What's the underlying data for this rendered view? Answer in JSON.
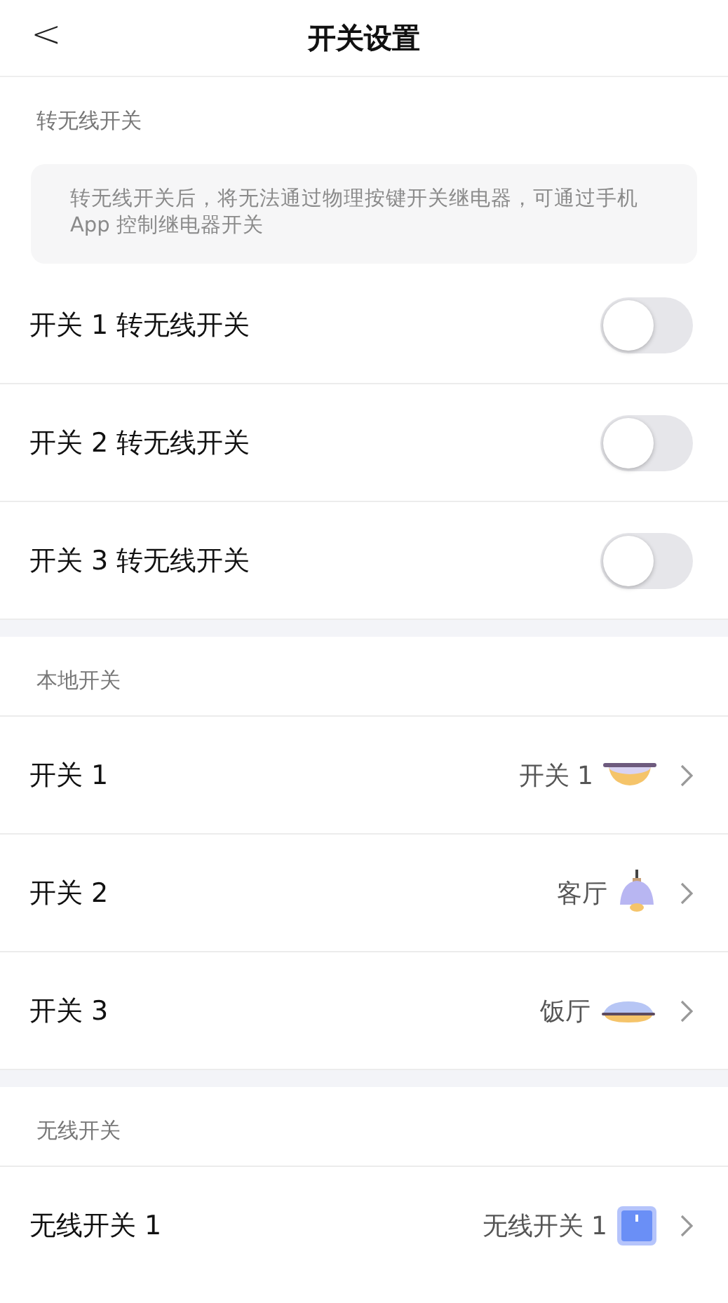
{
  "header": {
    "back": "<",
    "title": "开关设置"
  },
  "sections": [
    {
      "kind": "toggles",
      "title": "转无线开关",
      "note": "转无线开关后，将无法通过物理按键开关继电器，可通过手机 App 控制继电器开关",
      "items": [
        {
          "label": "开关 1 转无线开关",
          "on": false
        },
        {
          "label": "开关 2 转无线开关",
          "on": false
        },
        {
          "label": "开关 3 转无线开关",
          "on": false
        }
      ]
    },
    {
      "kind": "links",
      "title": "本地开关",
      "items": [
        {
          "label": "开关 1",
          "value": "开关 1",
          "kind": "ceiling"
        },
        {
          "label": "开关 2",
          "value": "客厅",
          "kind": "pendant"
        },
        {
          "label": "开关 3",
          "value": "饭厅",
          "kind": "flat"
        }
      ]
    },
    {
      "kind": "links",
      "title": "无线开关",
      "items": [
        {
          "label": "无线开关 1",
          "value": "无线开关 1",
          "kind": "panel"
        }
      ]
    }
  ]
}
